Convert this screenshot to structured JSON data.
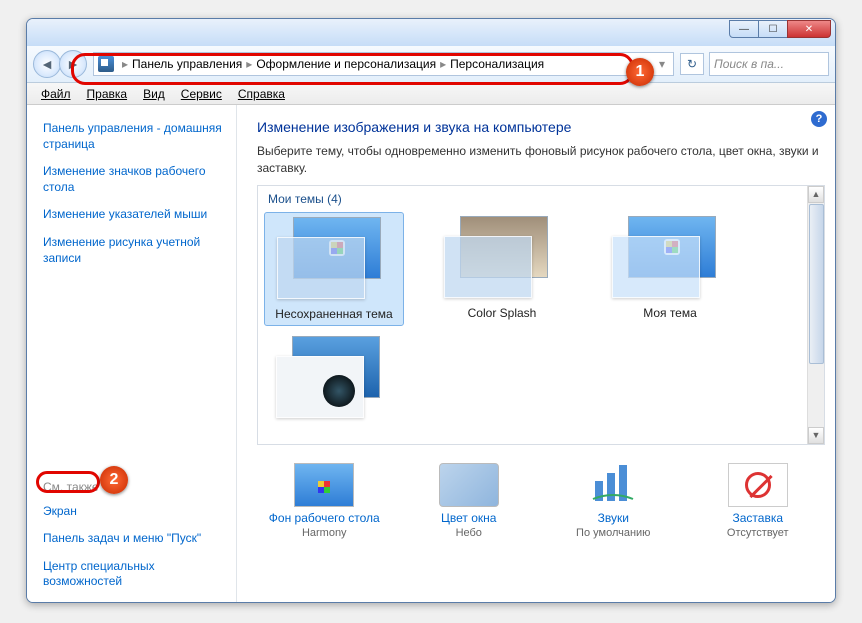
{
  "window_controls": {
    "min": "—",
    "max": "☐",
    "close": "✕"
  },
  "breadcrumb": {
    "items": [
      "Панель управления",
      "Оформление и персонализация",
      "Персонализация"
    ]
  },
  "refresh_glyph": "↻",
  "search": {
    "placeholder": "Поиск в па..."
  },
  "menubar": [
    "Файл",
    "Правка",
    "Вид",
    "Сервис",
    "Справка"
  ],
  "left_pane": {
    "home": "Панель управления - домашняя страница",
    "links": [
      "Изменение значков рабочего стола",
      "Изменение указателей мыши",
      "Изменение рисунка учетной записи"
    ],
    "see_also_label": "См. также",
    "see_also": [
      "Экран",
      "Панель задач и меню \"Пуск\"",
      "Центр специальных возможностей"
    ]
  },
  "main": {
    "title": "Изменение изображения и звука на компьютере",
    "desc": "Выберите тему, чтобы одновременно изменить фоновый рисунок рабочего стола, цвет окна, звуки и заставку.",
    "themes_header": "Мои темы (4)",
    "themes": [
      {
        "label": "Несохраненная тема",
        "class": "selected"
      },
      {
        "label": "Color Splash",
        "class": "colorsplash"
      },
      {
        "label": "Моя тема",
        "class": "mytheme"
      },
      {
        "label": "",
        "class": "extra"
      }
    ],
    "bottom": [
      {
        "label": "Фон рабочего стола",
        "sub": "Harmony",
        "kind": "wall"
      },
      {
        "label": "Цвет окна",
        "sub": "Небо",
        "kind": "color"
      },
      {
        "label": "Звуки",
        "sub": "По умолчанию",
        "kind": "sound"
      },
      {
        "label": "Заставка",
        "sub": "Отсутствует",
        "kind": "saver"
      }
    ]
  },
  "help_glyph": "?",
  "annotations": {
    "badge1": "1",
    "badge2": "2"
  }
}
